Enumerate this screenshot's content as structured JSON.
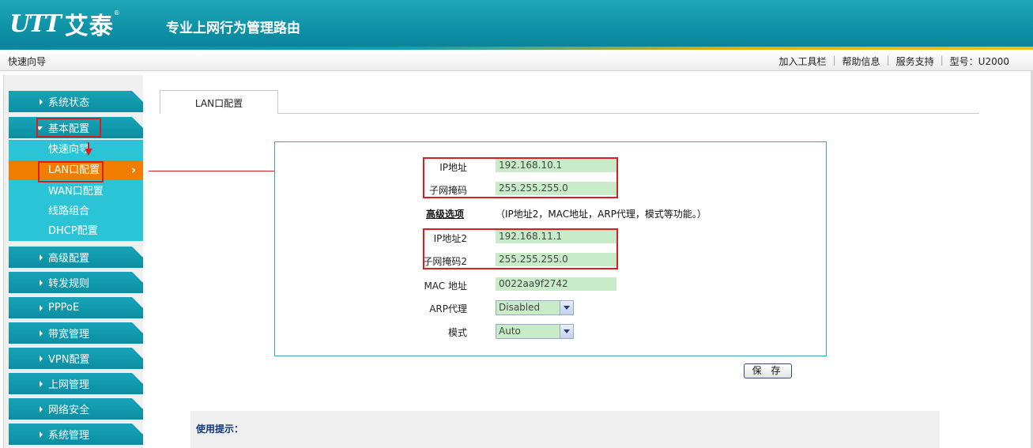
{
  "header": {
    "logo_mark": "UTT",
    "logo_text": "艾泰",
    "logo_reg": "®",
    "product_title": "专业上网行为管理路由"
  },
  "subbar": {
    "breadcrumb": "快速向导",
    "links": [
      "加入工具栏",
      "帮助信息",
      "服务支持"
    ],
    "model": "型号：U2000"
  },
  "sidebar": {
    "menu": [
      {
        "label": "系统状态"
      },
      {
        "label": "基本配置",
        "open": true
      },
      {
        "label": "高级配置"
      },
      {
        "label": "转发规则"
      },
      {
        "label": "PPPoE"
      },
      {
        "label": "带宽管理"
      },
      {
        "label": "VPN配置"
      },
      {
        "label": "上网管理"
      },
      {
        "label": "网络安全"
      },
      {
        "label": "系统管理"
      }
    ],
    "submenu": [
      {
        "label": "快速向导"
      },
      {
        "label": "LAN口配置",
        "active": true
      },
      {
        "label": "WAN口配置"
      },
      {
        "label": "线路组合"
      },
      {
        "label": "DHCP配置"
      }
    ],
    "active_chevron": "›"
  },
  "tab": {
    "label": "LAN口配置"
  },
  "form": {
    "ip_label": "IP地址",
    "ip_value": "192.168.10.1",
    "mask_label": "子网掩码",
    "mask_value": "255.255.255.0",
    "advanced_label": "高级选项",
    "advanced_desc": "（IP地址2，MAC地址，ARP代理，模式等功能。）",
    "ip2_label": "IP地址2",
    "ip2_value": "192.168.11.1",
    "mask2_label": "子网掩码2",
    "mask2_value": "255.255.255.0",
    "mac_label": "MAC 地址",
    "mac_value": "0022aa9f2742",
    "arp_label": "ARP代理",
    "arp_value": "Disabled",
    "mode_label": "模式",
    "mode_value": "Auto"
  },
  "save_button": "保 存",
  "hints": {
    "title": "使用提示："
  },
  "colors": {
    "accent": "#0f93a8",
    "active": "#f07c00",
    "annotation": "#d81e1e",
    "field": "#c8ecc8"
  }
}
